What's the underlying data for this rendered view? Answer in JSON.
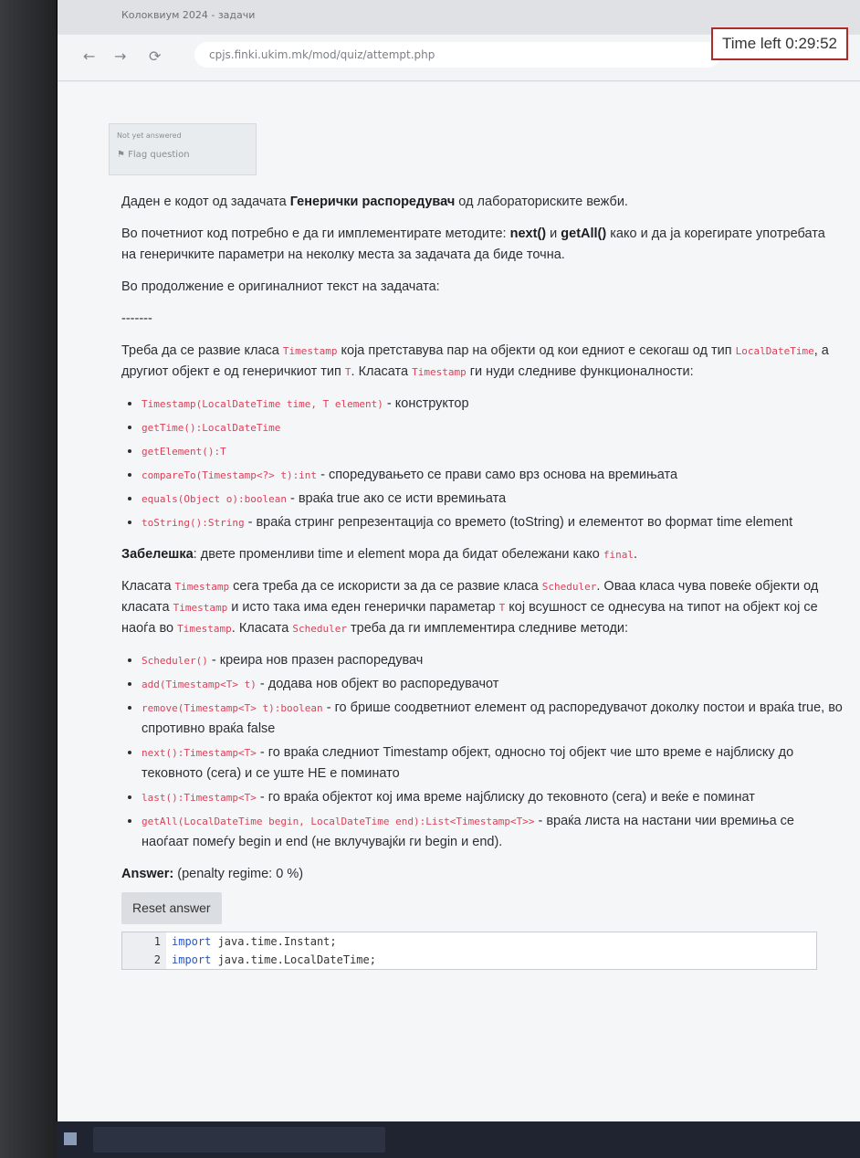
{
  "browser": {
    "tab_title": "Колоквиум 2024 - задачи",
    "url": "cpjs.finki.ukim.mk/mod/quiz/attempt.php",
    "timer": "Time left 0:29:52"
  },
  "info": {
    "status": "Not yet answered",
    "flag": "Flag question"
  },
  "question": {
    "p1_a": "Даден е кодот од задачата ",
    "p1_bold": "Генерички распоредувач",
    "p1_b": " од лабораториските вежби.",
    "p2_a": "Во почетниот код потребно е да ги имплементирате методите: ",
    "p2_next": "next()",
    "p2_and": " и ",
    "p2_getall": "getAll()",
    "p2_b": " како и да ја корегирате употребата на генеричките параметри на неколку места за задачата да биде точна.",
    "p3": "Во продолжение е оригиналниот текст на задачата:",
    "sep": "-------",
    "p4_a": "Треба да се развие класа ",
    "p4_ts": "Timestamp",
    "p4_b": " која претставува пар на објекти од кои едниот е секогаш од тип ",
    "p4_ldt": "LocalDateTime",
    "p4_c": ", а другиот објект е од генеричкиот тип ",
    "p4_t": "T",
    "p4_d": ". Класата ",
    "p4_ts2": "Timestamp",
    "p4_e": " ги нуди следниве функционалности:",
    "list1": [
      {
        "code": "Timestamp(LocalDateTime time, T element)",
        "text": " - конструктор"
      },
      {
        "code": "getTime():LocalDateTime",
        "text": ""
      },
      {
        "code": "getElement():T",
        "text": ""
      },
      {
        "code": "compareTo(Timestamp<?> t):int",
        "text": " - споредувањето се прави само врз основа на времињата"
      },
      {
        "code": "equals(Object o):boolean",
        "text": " - враќа true ако се исти времињата"
      },
      {
        "code": "toString():String",
        "text": " - враќа стринг репрезентација со времето (toString) и елементот во формат time element"
      }
    ],
    "note_label": "Забелешка",
    "note_text": ": двете променливи time и element мора да бидат обележани како ",
    "note_final": "final",
    "note_end": ".",
    "p5_a": "Класата ",
    "p5_ts": "Timestamp",
    "p5_b": " сега треба да се искористи за да се развие класа ",
    "p5_sch": "Scheduler",
    "p5_c": ". Оваа класа чува повеќе објекти од класата ",
    "p5_ts2": "Timestamp",
    "p5_d": " и исто така има еден генерички параметар ",
    "p5_t": "T",
    "p5_e": " кој всушност се однесува на типот на објект кој се наоѓа во ",
    "p5_ts3": "Timestamp",
    "p5_f": ". Класата ",
    "p5_sch2": "Scheduler",
    "p5_g": " треба да ги имплементира следниве методи:",
    "list2": [
      {
        "code": "Scheduler()",
        "text": " - креира нов празен распоредувач"
      },
      {
        "code": "add(Timestamp<T> t)",
        "text": " - додава нов објект во распоредувачот"
      },
      {
        "code": "remove(Timestamp<T> t):boolean",
        "text": " - го брише соодветниот елемент од распоредувачот доколку постои и враќа true, во спротивно враќа false"
      },
      {
        "code": "next():Timestamp<T>",
        "text": " - го враќа следниот Timestamp објект, односно тој објект чие што време е најблиску до тековното (сега) и се уште НЕ е поминато"
      },
      {
        "code": "last():Timestamp<T>",
        "text": " - го враќа објектот кој има време најблиску до тековното (сега) и веќе е поминат"
      },
      {
        "code": "getAll(LocalDateTime begin, LocalDateTime end):List<Timestamp<T>>",
        "text": " - враќа листа на настани чии времиња се наоѓаат помеѓу begin и end (не вклучувајќи ги begin и end)."
      }
    ]
  },
  "answer": {
    "label": "Answer:",
    "penalty": "(penalty regime: 0 %)",
    "reset": "Reset answer",
    "lines": [
      {
        "num": "1",
        "kw": "import",
        "rest": " java.time.Instant;"
      },
      {
        "num": "2",
        "kw": "import",
        "rest": " java.time.LocalDateTime;"
      }
    ]
  }
}
